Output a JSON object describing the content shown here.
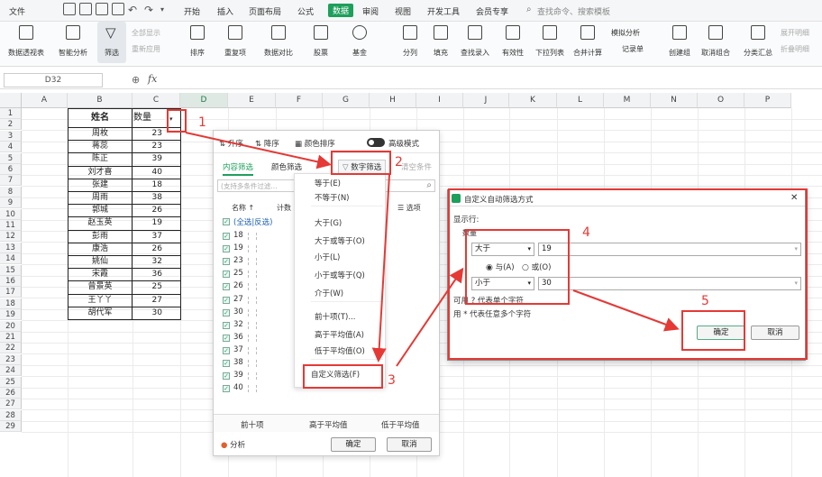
{
  "menubar": {
    "file": "文件",
    "items": [
      "开始",
      "插入",
      "页面布局",
      "公式",
      "数据",
      "审阅",
      "视图",
      "开发工具",
      "会员专享"
    ],
    "active_index": 4,
    "search_placeholder": "查找命令、搜索模板"
  },
  "ribbon": {
    "pivot": "数据透视表",
    "smart_analysis": "智能分析",
    "filter": "筛选",
    "show_all": "全部显示",
    "reapply": "重新应用",
    "sort": "排序",
    "duplicates": "重复项",
    "compare": "数据对比",
    "stock": "股票",
    "fund": "基金",
    "split": "分列",
    "fill": "填充",
    "lookup": "查找录入",
    "validity": "有效性",
    "dropdown": "下拉列表",
    "merge_calc": "合并计算",
    "simulate": "模拟分析",
    "record": "记录单",
    "group": "创建组",
    "ungroup": "取消组合",
    "subtotal": "分类汇总",
    "expand": "展开明细",
    "collapse": "折叠明细"
  },
  "formula": {
    "namebox": "D32",
    "fx": "fx"
  },
  "columns": [
    "A",
    "B",
    "C",
    "D",
    "E",
    "F",
    "G",
    "H",
    "I",
    "J",
    "K",
    "L",
    "M",
    "N",
    "O",
    "P"
  ],
  "rows": [
    "1",
    "2",
    "3",
    "4",
    "5",
    "6",
    "7",
    "8",
    "9",
    "10",
    "11",
    "12",
    "13",
    "14",
    "15",
    "16",
    "17",
    "18",
    "19",
    "20",
    "21",
    "22",
    "23",
    "24",
    "25",
    "26",
    "27",
    "28",
    "29"
  ],
  "table": {
    "header_name": "姓名",
    "header_qty": "数量",
    "names": [
      "周枚",
      "蒋蕊",
      "陈正",
      "刘才喜",
      "张建",
      "周雨",
      "郭城",
      "赵玉英",
      "彭雨",
      "康浩",
      "姚仙",
      "宋霞",
      "曾景英",
      "王丫丫",
      "胡代军"
    ],
    "qty": [
      "23",
      "23",
      "39",
      "40",
      "18",
      "38",
      "26",
      "19",
      "37",
      "26",
      "32",
      "36",
      "25",
      "27",
      "30"
    ]
  },
  "filter_panel": {
    "asc": "升序",
    "desc": "降序",
    "color_sort": "颜色排序",
    "advanced": "高级模式",
    "tab_content": "内容筛选",
    "tab_color": "颜色筛选",
    "tab_number": "数字筛选",
    "tab_clear": "清空条件",
    "search_placeholder": "(支持多条件过滤...",
    "col_name": "名称",
    "col_count": "计数",
    "options": "选项",
    "select_all": "(全选|反选)",
    "values": [
      "18",
      "19",
      "23",
      "25",
      "26",
      "27",
      "30",
      "32",
      "36",
      "37",
      "38",
      "39",
      "40"
    ],
    "top10": "前十项",
    "above_avg": "高于平均值",
    "below_avg": "低于平均值",
    "analysis": "分析",
    "ok": "确定",
    "cancel": "取消"
  },
  "submenu": {
    "items": [
      "等于(E)",
      "不等于(N)",
      "大于(G)",
      "大于或等于(O)",
      "小于(L)",
      "小于或等于(Q)",
      "介于(W)",
      "前十项(T)...",
      "高于平均值(A)",
      "低于平均值(O)",
      "自定义筛选(F)"
    ]
  },
  "dialog": {
    "title": "自定义自动筛选方式",
    "show_rows": "显示行:",
    "field": "数量",
    "op1": "大于",
    "val1": "19",
    "and": "与(A)",
    "or": "或(O)",
    "op2": "小于",
    "val2": "30",
    "hint1": "可用 ? 代表单个字符",
    "hint2": "用 * 代表任意多个字符",
    "ok": "确定",
    "cancel": "取消",
    "close": "✕"
  },
  "annotations": [
    "1",
    "2",
    "3",
    "4",
    "5"
  ]
}
